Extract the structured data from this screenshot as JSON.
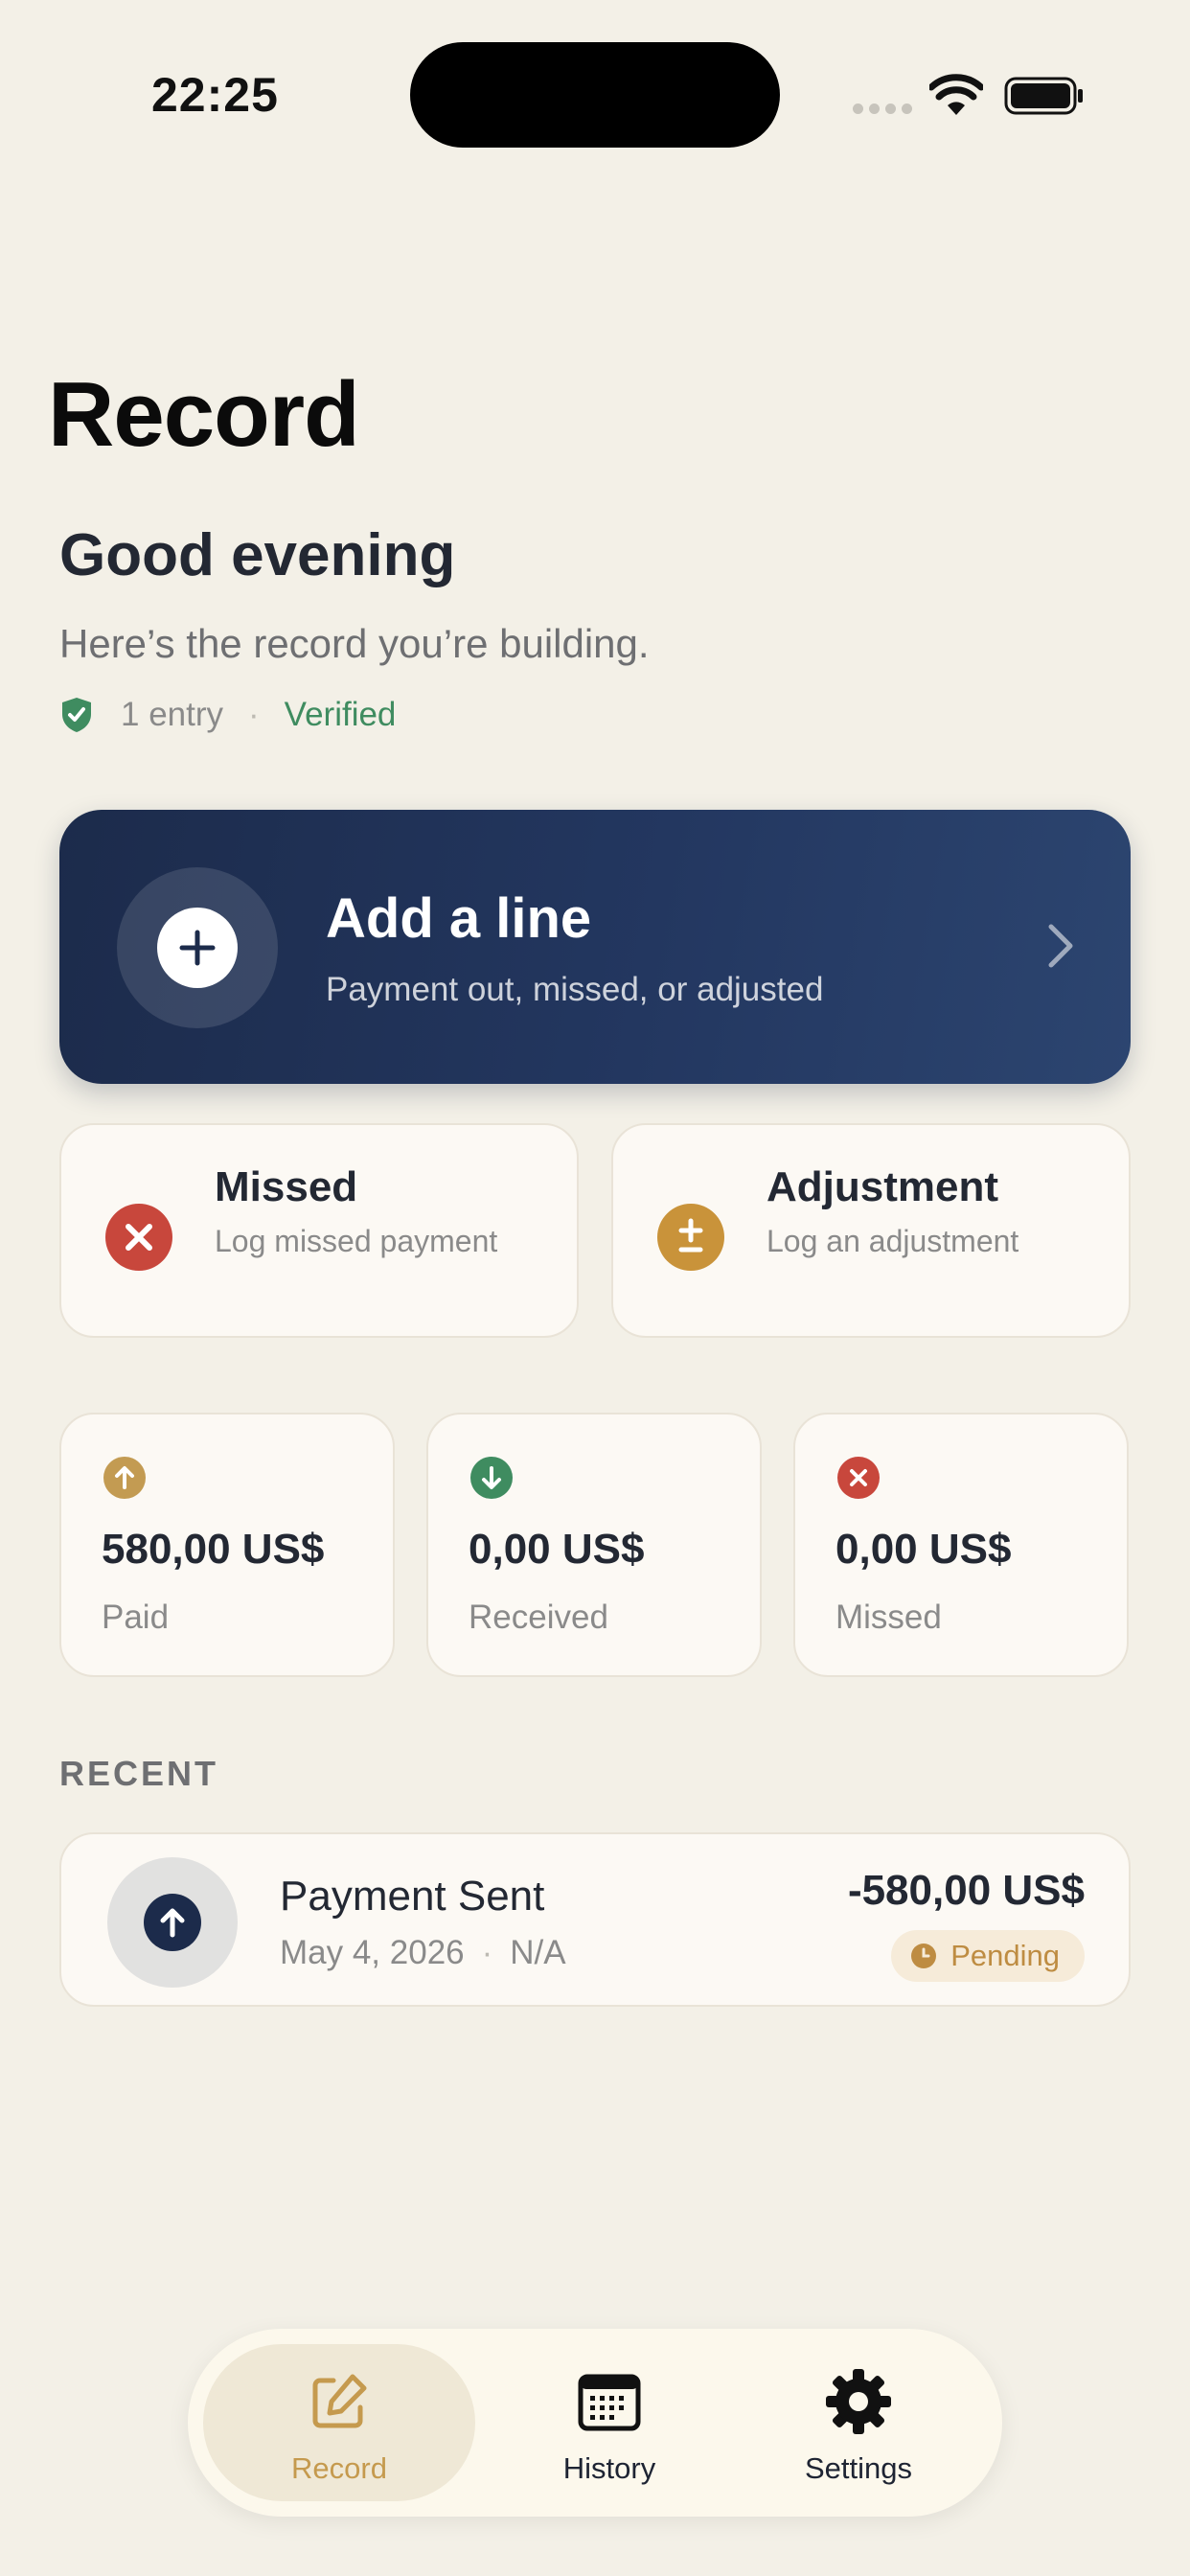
{
  "status_bar": {
    "time": "22:25"
  },
  "page": {
    "title": "Record"
  },
  "header": {
    "greeting": "Good evening",
    "subtitle": "Here’s the record you’re building.",
    "entry_count": "1 entry",
    "verified": "Verified"
  },
  "add_card": {
    "title": "Add a line",
    "subtitle": "Payment out, missed, or adjusted",
    "icon": "plus-icon"
  },
  "quick_actions": {
    "missed": {
      "title": "Missed",
      "subtitle": "Log missed payment",
      "icon": "x-circle-icon",
      "color": "#C8473C"
    },
    "adjustment": {
      "title": "Adjustment",
      "subtitle": "Log an adjustment",
      "icon": "plus-minus-icon",
      "color": "#C9933A"
    }
  },
  "stats": {
    "paid": {
      "value": "580,00 US$",
      "label": "Paid",
      "color": "#C39B52"
    },
    "received": {
      "value": "0,00 US$",
      "label": "Received",
      "color": "#3F8C60"
    },
    "missed": {
      "value": "0,00 US$",
      "label": "Missed",
      "color": "#C8473C"
    }
  },
  "recent": {
    "label": "RECENT",
    "items": [
      {
        "title": "Payment Sent",
        "date": "May 4, 2026",
        "note": "N/A",
        "amount": "-580,00 US$",
        "status": "Pending"
      }
    ]
  },
  "tab_bar": {
    "tabs": [
      {
        "label": "Record",
        "icon": "edit-icon",
        "active": true
      },
      {
        "label": "History",
        "icon": "calendar-icon",
        "active": false
      },
      {
        "label": "Settings",
        "icon": "gear-icon",
        "active": false
      }
    ]
  },
  "colors": {
    "background": "#F3F0E7",
    "navy": "#1C2B4B",
    "gold": "#C59A4E",
    "green": "#3F8C60"
  }
}
